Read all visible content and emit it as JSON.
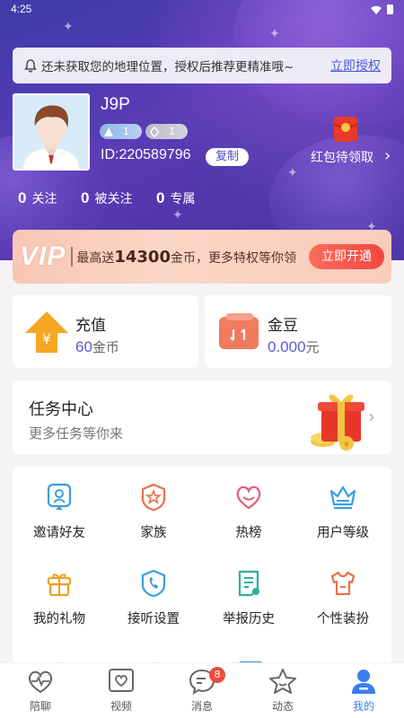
{
  "status_bar": {
    "time": "4:25"
  },
  "location_notice": {
    "text": "还未获取您的地理位置，授权后推荐更精准哦~",
    "action": "立即授权"
  },
  "profile": {
    "nickname": "J9P",
    "badge_1_level": "1",
    "badge_2_level": "1",
    "id_text": "ID:220589796",
    "copy_label": "复制",
    "red_packet_label": "红包待领取"
  },
  "stats": [
    {
      "count": "0",
      "label": "关注"
    },
    {
      "count": "0",
      "label": "被关注"
    },
    {
      "count": "0",
      "label": "专属"
    }
  ],
  "vip_banner": {
    "logo": "VIP",
    "text_prefix": "最高送",
    "amount": "14300",
    "text_suffix": "金币，更多特权等你领",
    "button": "立即开通"
  },
  "wallet": {
    "recharge": {
      "title": "充值",
      "value": "60",
      "unit": "金币"
    },
    "beans": {
      "title": "金豆",
      "value": "0.000",
      "unit": "元"
    }
  },
  "task_center": {
    "title": "任务中心",
    "subtitle": "更多任务等你来"
  },
  "grid": [
    {
      "label": "邀请好友",
      "icon": "invite-icon",
      "color": "#3a9de0"
    },
    {
      "label": "家族",
      "icon": "family-icon",
      "color": "#e8704a"
    },
    {
      "label": "热榜",
      "icon": "heart-icon",
      "color": "#e8587a"
    },
    {
      "label": "用户等级",
      "icon": "crown-icon",
      "color": "#3a9de0"
    },
    {
      "label": "我的礼物",
      "icon": "gift-icon",
      "color": "#f0a020"
    },
    {
      "label": "接听设置",
      "icon": "phone-icon",
      "color": "#3a9de0"
    },
    {
      "label": "举报历史",
      "icon": "report-icon",
      "color": "#2ab0a0"
    },
    {
      "label": "个性装扮",
      "icon": "shirt-icon",
      "color": "#e8704a"
    }
  ],
  "tabs": [
    {
      "label": "陪聊",
      "icon": "heartbeat-icon"
    },
    {
      "label": "视频",
      "icon": "video-heart-icon"
    },
    {
      "label": "消息",
      "icon": "message-icon",
      "badge": "8"
    },
    {
      "label": "动态",
      "icon": "star-icon"
    },
    {
      "label": "我的",
      "icon": "profile-icon",
      "active": true
    }
  ],
  "colors": {
    "accent": "#3a7df0",
    "hero": "#4a3ab0",
    "vip_button": "#f0473f",
    "link": "#4a5ad6"
  }
}
